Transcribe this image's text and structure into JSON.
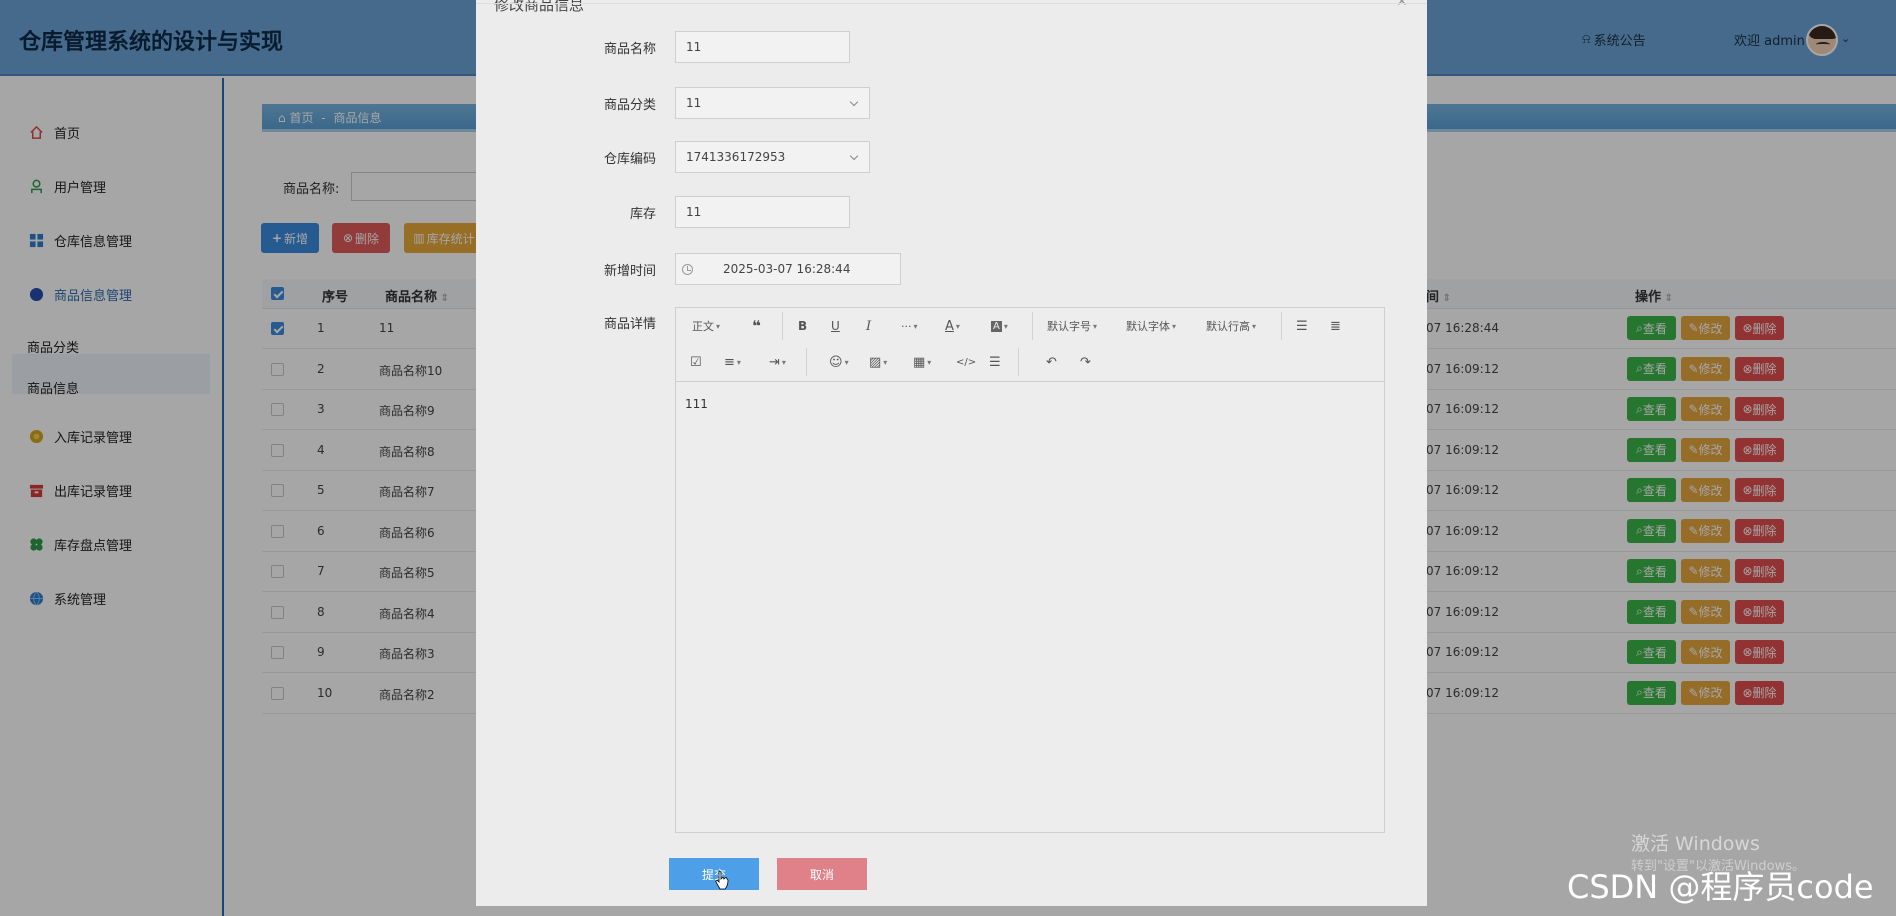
{
  "app": {
    "title": "仓库管理系统的设计与实现"
  },
  "header": {
    "notice_label": "系统公告",
    "welcome_label": "欢迎 admin"
  },
  "sidebar": {
    "items": [
      {
        "label": "首页"
      },
      {
        "label": "用户管理"
      },
      {
        "label": "仓库信息管理"
      },
      {
        "label": "商品信息管理"
      },
      {
        "label": "入库记录管理"
      },
      {
        "label": "出库记录管理"
      },
      {
        "label": "库存盘点管理"
      },
      {
        "label": "系统管理"
      }
    ],
    "subitems": [
      {
        "label": "商品分类"
      },
      {
        "label": "商品信息"
      }
    ]
  },
  "breadcrumb": {
    "home": "首页",
    "sep": "-",
    "current": "商品信息"
  },
  "search": {
    "label": "商品名称:",
    "value": ""
  },
  "toolbar": {
    "add_label": "新增",
    "delete_label": "删除",
    "stat_label": "库存统计"
  },
  "table": {
    "headers": {
      "index": "序号",
      "name": "商品名称",
      "time": "间",
      "action": "操作"
    },
    "rows": [
      {
        "index": "1",
        "name": "11",
        "time": "07 16:28:44",
        "checked": true
      },
      {
        "index": "2",
        "name": "商品名称10",
        "time": "07 16:09:12",
        "checked": false
      },
      {
        "index": "3",
        "name": "商品名称9",
        "time": "07 16:09:12",
        "checked": false
      },
      {
        "index": "4",
        "name": "商品名称8",
        "time": "07 16:09:12",
        "checked": false
      },
      {
        "index": "5",
        "name": "商品名称7",
        "time": "07 16:09:12",
        "checked": false
      },
      {
        "index": "6",
        "name": "商品名称6",
        "time": "07 16:09:12",
        "checked": false
      },
      {
        "index": "7",
        "name": "商品名称5",
        "time": "07 16:09:12",
        "checked": false
      },
      {
        "index": "8",
        "name": "商品名称4",
        "time": "07 16:09:12",
        "checked": false
      },
      {
        "index": "9",
        "name": "商品名称3",
        "time": "07 16:09:12",
        "checked": false
      },
      {
        "index": "10",
        "name": "商品名称2",
        "time": "07 16:09:12",
        "checked": false
      }
    ],
    "row_buttons": {
      "view": "查看",
      "edit": "修改",
      "delete": "删除"
    }
  },
  "modal": {
    "title": "修改商品信息",
    "fields": {
      "name": {
        "label": "商品名称",
        "value": "11"
      },
      "category": {
        "label": "商品分类",
        "value": "11"
      },
      "warehouse": {
        "label": "仓库编码",
        "value": "1741336172953"
      },
      "stock": {
        "label": "库存",
        "value": "11"
      },
      "time": {
        "label": "新增时间",
        "value": "2025-03-07 16:28:44"
      },
      "detail": {
        "label": "商品详情",
        "content": "111"
      }
    },
    "editor_toolbar": {
      "paragraph": "正文",
      "font_size": "默认字号",
      "font_family": "默认字体",
      "line_height": "默认行高",
      "more": "···"
    },
    "submit_label": "提交",
    "cancel_label": "取消"
  },
  "watermarks": {
    "activate": "激活 Windows",
    "activate_hint": "转到\"设置\"以激活Windows。",
    "csdn": "CSDN @程序员code"
  },
  "colors": {
    "header": "#6aa3d6",
    "primary": "#3b8de0",
    "danger": "#e05b5b",
    "warning": "#e7a93a",
    "success": "#3cb54a"
  }
}
